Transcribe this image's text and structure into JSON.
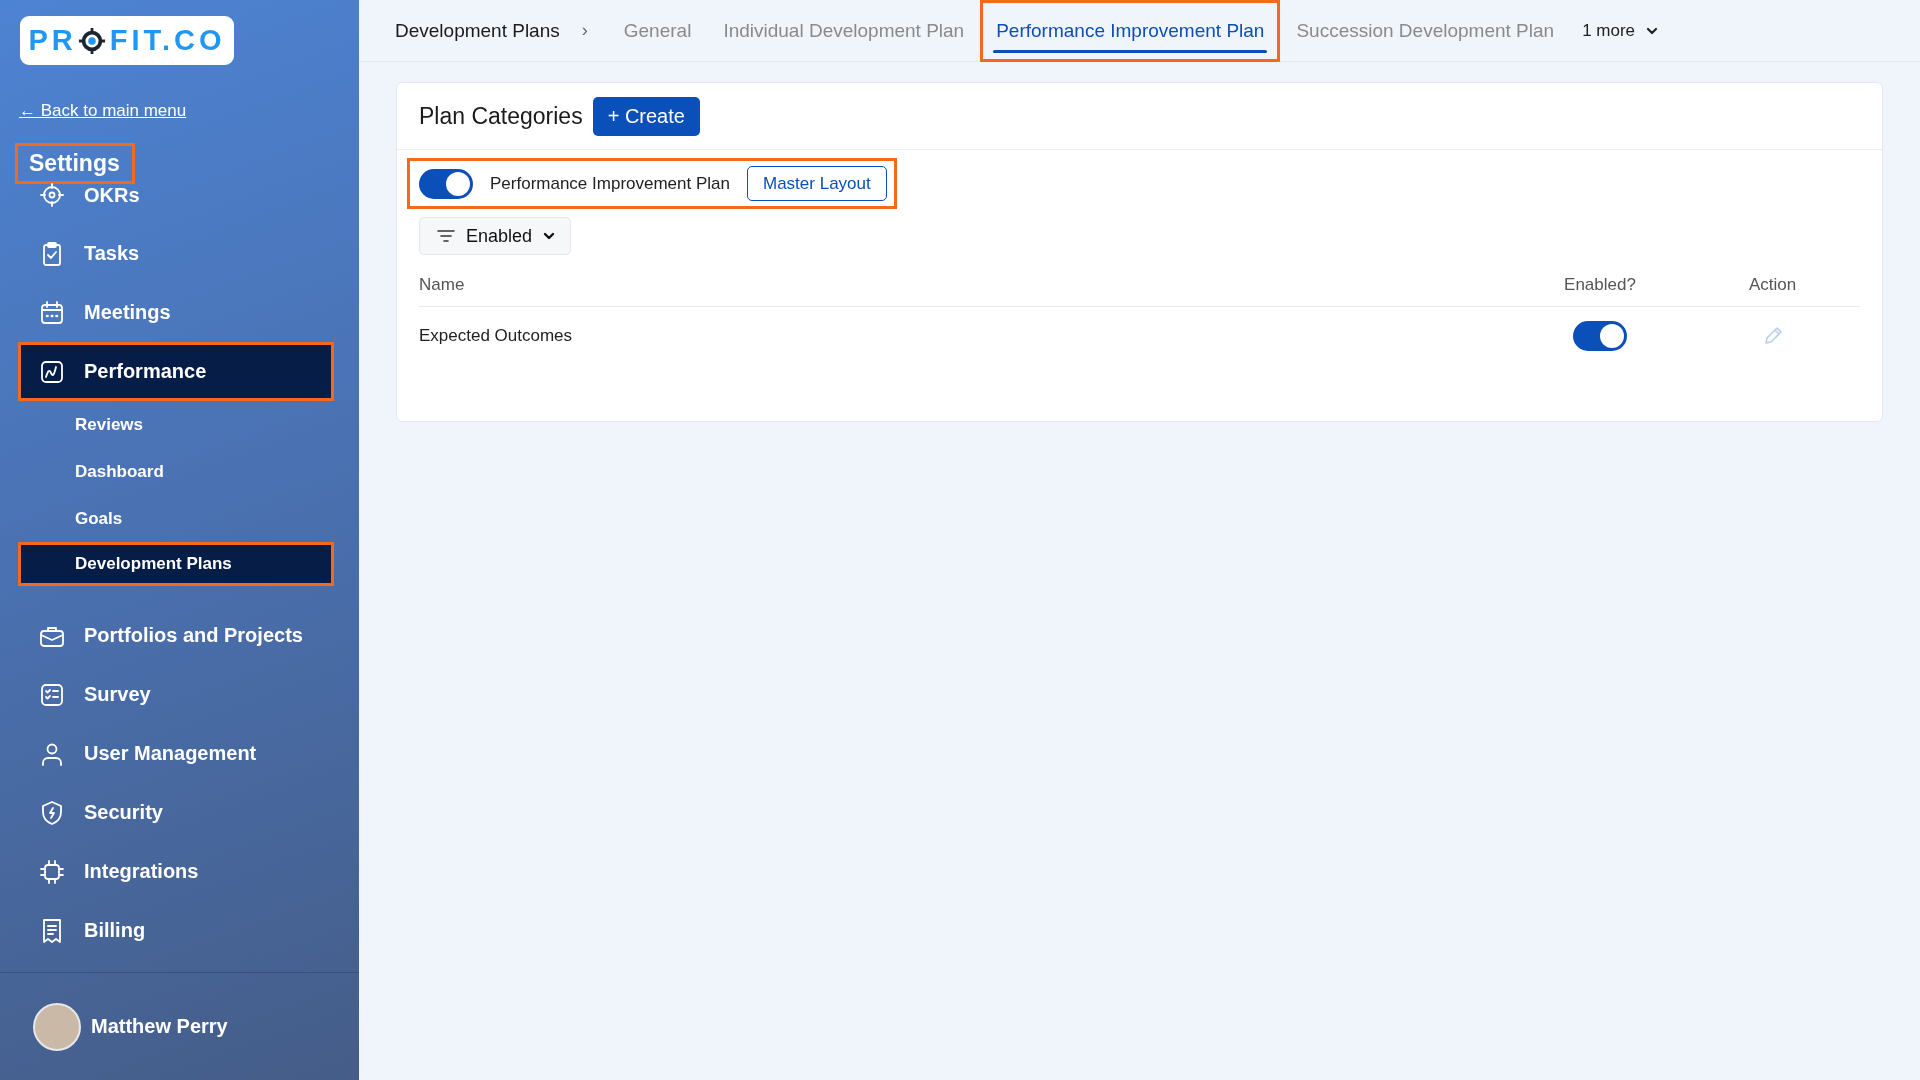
{
  "sidebar": {
    "logo": {
      "before": "PR",
      "after": "FIT.CO"
    },
    "back_link": "← Back to main menu",
    "title": {
      "text": "Settings",
      "highlighted": true
    },
    "items": [
      {
        "label": "OKRs",
        "selected": false,
        "highlighted": false
      },
      {
        "label": "Tasks",
        "selected": false,
        "highlighted": false
      },
      {
        "label": "Meetings",
        "selected": false,
        "highlighted": false
      },
      {
        "label": "Performance",
        "selected": true,
        "highlighted": true,
        "children": [
          {
            "label": "Reviews",
            "selected": false,
            "highlighted": false
          },
          {
            "label": "Dashboard",
            "selected": false,
            "highlighted": false
          },
          {
            "label": "Goals",
            "selected": false,
            "highlighted": false
          },
          {
            "label": "Development Plans",
            "selected": true,
            "highlighted": true
          }
        ]
      },
      {
        "label": "Portfolios and Projects",
        "selected": false,
        "highlighted": false
      },
      {
        "label": "Survey",
        "selected": false,
        "highlighted": false
      },
      {
        "label": "User Management",
        "selected": false,
        "highlighted": false
      },
      {
        "label": "Security",
        "selected": false,
        "highlighted": false
      },
      {
        "label": "Integrations",
        "selected": false,
        "highlighted": false
      },
      {
        "label": "Billing",
        "selected": false,
        "highlighted": false
      }
    ],
    "user": {
      "name": "Matthew Perry"
    }
  },
  "top_bar": {
    "breadcrumb": "Development Plans",
    "separator": "›",
    "tabs": [
      {
        "label": "General",
        "selected": false,
        "highlighted": false
      },
      {
        "label": "Individual Development Plan",
        "selected": false,
        "highlighted": false
      },
      {
        "label": "Performance Improvement Plan",
        "selected": true,
        "highlighted": true
      },
      {
        "label": "Succession Development Plan",
        "selected": false,
        "highlighted": false
      }
    ],
    "more": "1 more"
  },
  "card": {
    "title": "Plan Categories",
    "create_button": "+ Create",
    "plan_toggle": {
      "on": true,
      "label": "Performance Improvement Plan",
      "highlighted": true
    },
    "layout_button": "Master Layout",
    "filter": "Enabled",
    "table": {
      "columns": [
        "Name",
        "Enabled?",
        "Action"
      ],
      "rows": [
        {
          "name": "Expected Outcomes",
          "enabled": true
        }
      ]
    }
  }
}
